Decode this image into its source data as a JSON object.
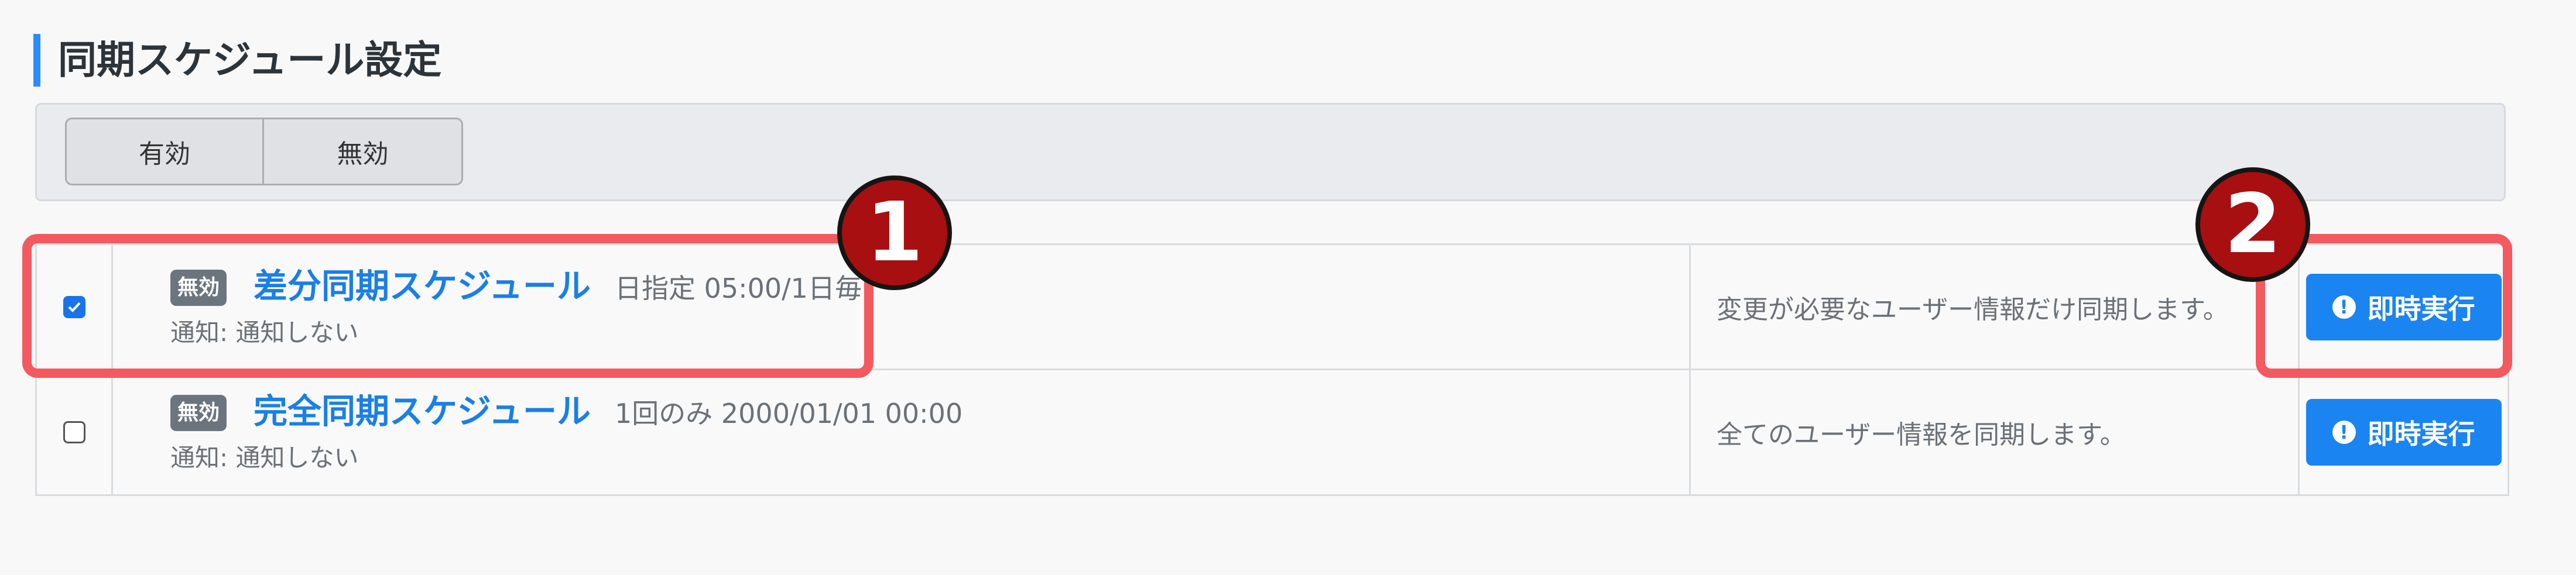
{
  "section": {
    "title": "同期スケジュール設定"
  },
  "toolbar": {
    "enable_label": "有効",
    "disable_label": "無効"
  },
  "rows": [
    {
      "checked": true,
      "badge": "無効",
      "name": "差分同期スケジュール",
      "schedule": "日指定 05:00/1日毎",
      "notify": "通知: 通知しない",
      "description": "変更が必要なユーザー情報だけ同期します。",
      "run_label": "即時実行"
    },
    {
      "checked": false,
      "badge": "無効",
      "name": "完全同期スケジュール",
      "schedule": "1回のみ 2000/01/01 00:00",
      "notify": "通知: 通知しない",
      "description": "全てのユーザー情報を同期します。",
      "run_label": "即時実行"
    }
  ],
  "callouts": {
    "first": "1",
    "second": "2"
  },
  "colors": {
    "accent": "#1a84f0",
    "highlight": "#f25a5f",
    "callout": "#a80f10",
    "badge": "#6c757d"
  },
  "icons": {
    "run": "exclamation-circle-icon",
    "check": "checkmark-icon"
  }
}
